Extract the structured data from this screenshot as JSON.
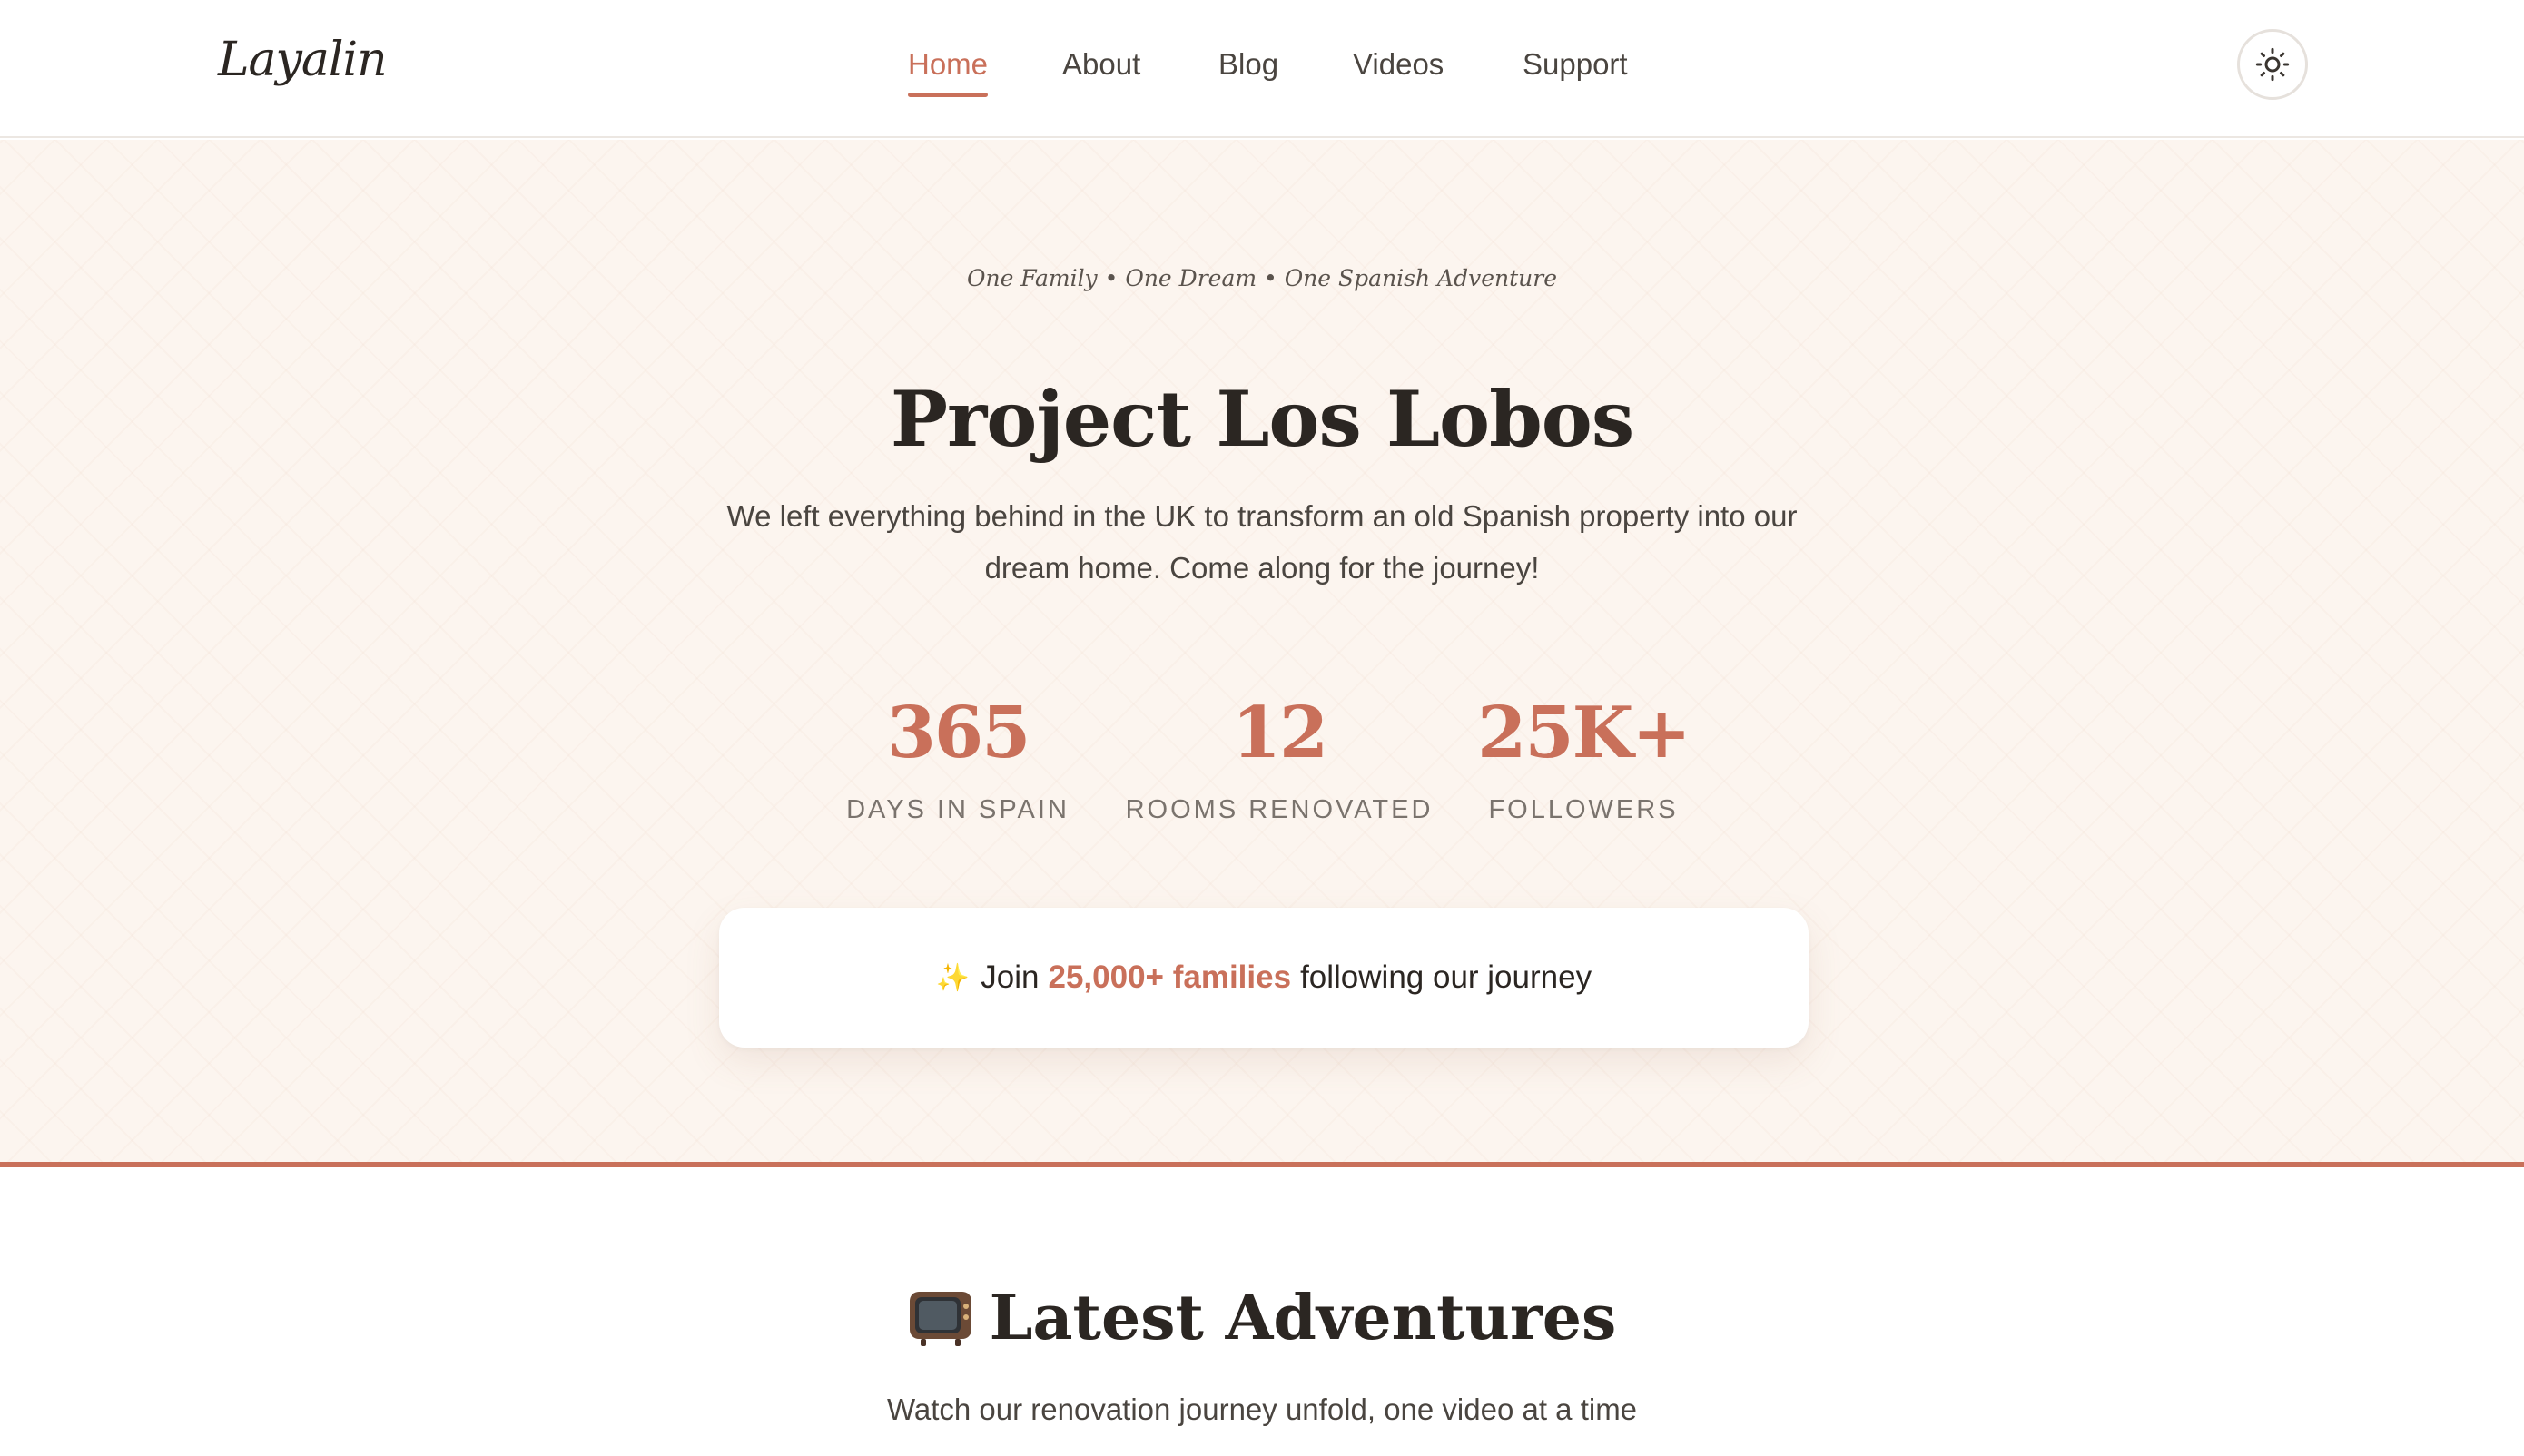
{
  "header": {
    "logo": "Layalin",
    "nav": [
      {
        "label": "Home",
        "active": true
      },
      {
        "label": "About",
        "active": false
      },
      {
        "label": "Blog",
        "active": false
      },
      {
        "label": "Videos",
        "active": false
      },
      {
        "label": "Support",
        "active": false
      }
    ],
    "theme_toggle_icon": "sun-icon"
  },
  "hero": {
    "tagline": "One Family • One Dream • One Spanish Adventure",
    "title": "Project Los Lobos",
    "subtitle": "We left everything behind in the UK to transform an old Spanish property into our dream home. Come along for the journey!",
    "stats": [
      {
        "value": "365",
        "label": "DAYS IN SPAIN"
      },
      {
        "value": "12",
        "label": "ROOMS RENOVATED"
      },
      {
        "value": "25K+",
        "label": "FOLLOWERS"
      }
    ],
    "join": {
      "icon": "sparkles-icon",
      "prefix": "Join",
      "highlight": "25,000+ families",
      "suffix": "following our journey"
    }
  },
  "latest": {
    "icon": "television-icon",
    "title": "Latest Adventures",
    "subtitle": "Watch our renovation journey unfold, one video at a time"
  },
  "colors": {
    "accent": "#c9705a",
    "hero_bg": "#fcf5ef",
    "text": "#2b2622"
  }
}
